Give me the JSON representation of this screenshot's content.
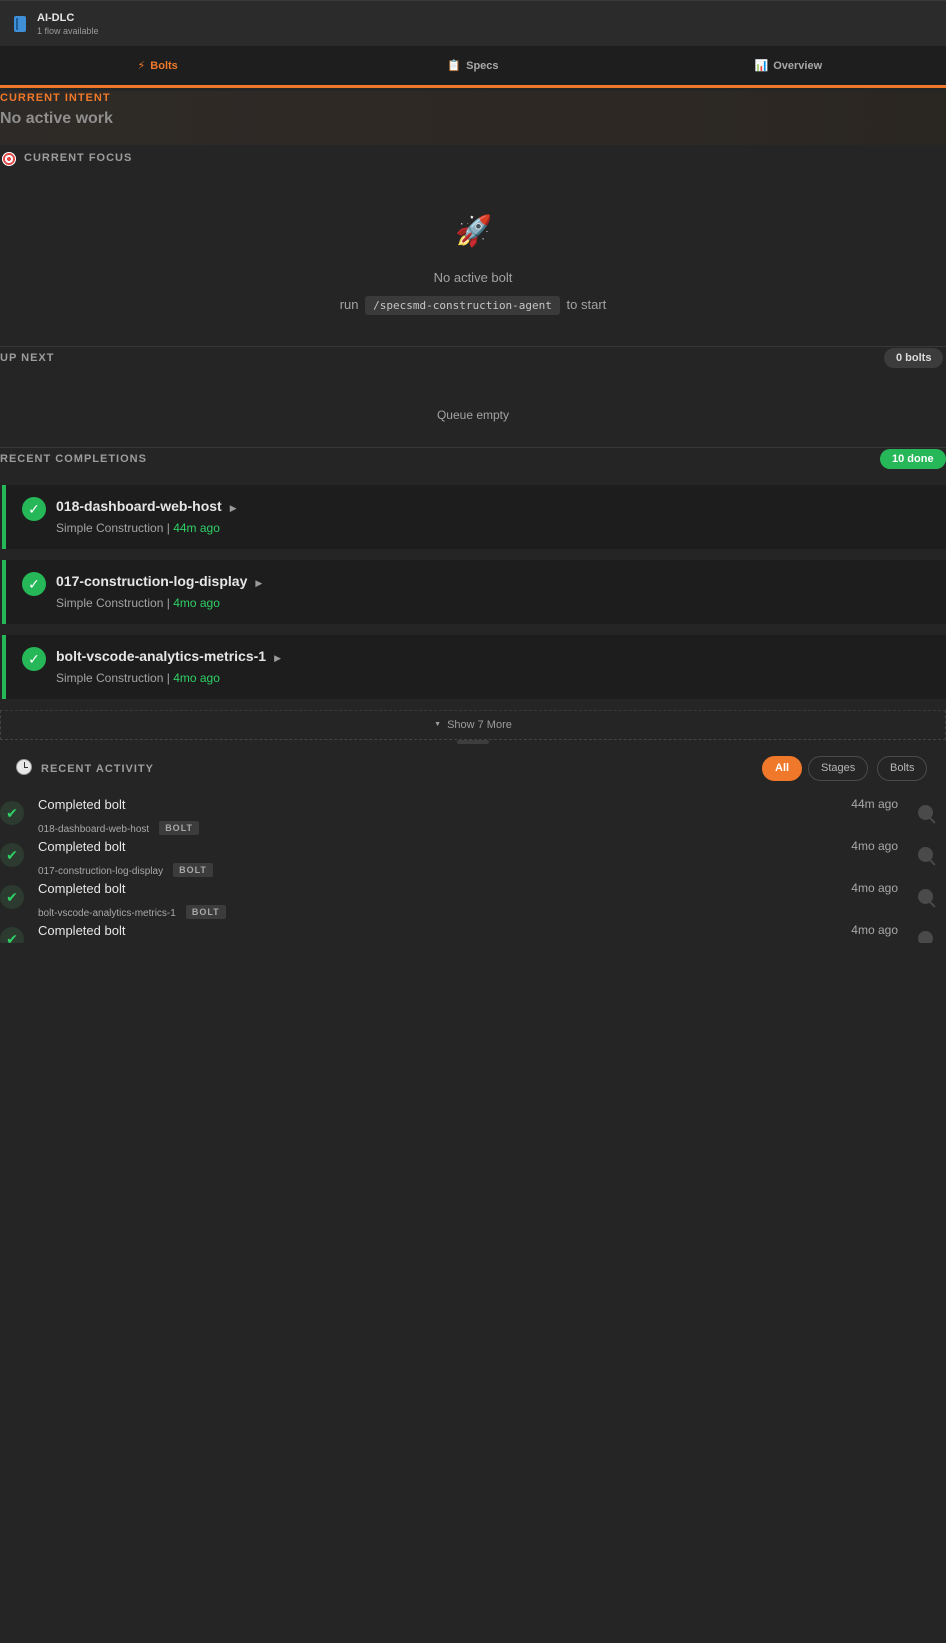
{
  "header": {
    "title": "AI-DLC",
    "subtitle": "1 flow available",
    "icon": "book-icon"
  },
  "tabs": [
    {
      "icon": "⚡",
      "label": "Bolts",
      "active": true
    },
    {
      "icon": "📋",
      "label": "Specs",
      "active": false
    },
    {
      "icon": "📊",
      "label": "Overview",
      "active": false
    }
  ],
  "intent": {
    "label": "CURRENT INTENT",
    "value": "No active work"
  },
  "focus": {
    "label": "CURRENT FOCUS",
    "empty_icon": "🚀",
    "empty_title": "No active bolt",
    "run_prefix": "run",
    "command": "/specsmd-construction-agent",
    "run_suffix": "to start"
  },
  "up_next": {
    "label": "UP NEXT",
    "count": "0 bolts",
    "empty": "Queue empty"
  },
  "completions": {
    "label": "RECENT COMPLETIONS",
    "count": "10 done",
    "items": [
      {
        "name": "018-dashboard-web-host",
        "type": "Simple Construction",
        "time": "44m ago"
      },
      {
        "name": "017-construction-log-display",
        "type": "Simple Construction",
        "time": "4mo ago"
      },
      {
        "name": "bolt-vscode-analytics-metrics-1",
        "type": "Simple Construction",
        "time": "4mo ago"
      }
    ],
    "show_more": "Show 7 More"
  },
  "activity": {
    "label": "RECENT ACTIVITY",
    "filters": [
      "All",
      "Stages",
      "Bolts"
    ],
    "active_filter": "All",
    "items": [
      {
        "title": "Completed bolt",
        "id": "018-dashboard-web-host",
        "badge": "BOLT",
        "time": "44m ago"
      },
      {
        "title": "Completed bolt",
        "id": "017-construction-log-display",
        "badge": "BOLT",
        "time": "4mo ago"
      },
      {
        "title": "Completed bolt",
        "id": "bolt-vscode-analytics-metrics-1",
        "badge": "BOLT",
        "time": "4mo ago"
      },
      {
        "title": "Completed bolt",
        "id": "",
        "badge": "",
        "time": "4mo ago"
      }
    ]
  },
  "colors": {
    "accent": "#f0782a",
    "success": "#26b858",
    "background": "#252525"
  }
}
